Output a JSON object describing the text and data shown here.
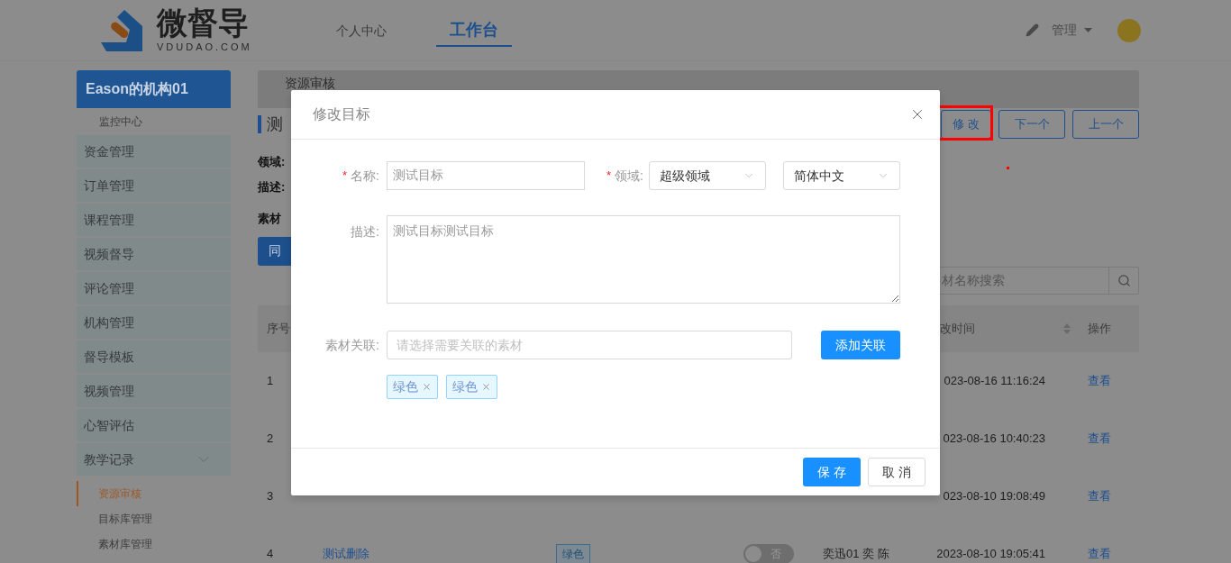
{
  "header": {
    "logo": {
      "name": "微督导",
      "domain": "VDUDAO.COM"
    },
    "nav": [
      {
        "label": "个人中心",
        "selected": false
      },
      {
        "label": "工作台",
        "selected": true
      }
    ],
    "user_menu": "管理"
  },
  "sidebar": {
    "org": "Eason的机构01",
    "top_link": "监控中心",
    "items": [
      {
        "label": "资金管理"
      },
      {
        "label": "订单管理"
      },
      {
        "label": "课程管理"
      },
      {
        "label": "视频督导"
      },
      {
        "label": "评论管理"
      },
      {
        "label": "机构管理"
      },
      {
        "label": "督导模板"
      },
      {
        "label": "视频管理"
      },
      {
        "label": "心智评估"
      },
      {
        "label": "教学记录",
        "expanded": true,
        "children": [
          {
            "label": "资源审核",
            "selected": true
          },
          {
            "label": "目标库管理",
            "selected": false
          },
          {
            "label": "素材库管理",
            "selected": false
          }
        ]
      }
    ]
  },
  "main": {
    "tab": "资源审核",
    "title": "测",
    "fields": [
      "领域:",
      "描述:",
      "素材"
    ],
    "action_buttons": [
      "修 改",
      "下一个",
      "上一个"
    ],
    "approve_button": "同",
    "search": {
      "placeholder": "材名称搜索"
    },
    "table": {
      "columns": [
        {
          "label": "序号"
        },
        {
          "label": "改时间",
          "sortable": true
        },
        {
          "label": "操作"
        }
      ],
      "rows": [
        {
          "index": "1",
          "time": "023-08-16 11:16:24",
          "action": "查看"
        },
        {
          "index": "2",
          "time": "023-08-16 10:40:23",
          "action": "查看"
        },
        {
          "index": "3",
          "time": "023-08-10 19:08:49",
          "action": "查看"
        },
        {
          "index": "4",
          "name": "测试删除",
          "tag": "绿色",
          "toggle": {
            "on": false,
            "label": "否"
          },
          "person": "奕迅01 奕 陈",
          "time": "2023-08-10 19:05:41",
          "action": "查看"
        }
      ]
    }
  },
  "modal": {
    "title": "修改目标",
    "name": {
      "label": "名称:",
      "required_mark": "*",
      "value": "测试目标"
    },
    "domain": {
      "label": "领域:",
      "required_mark": "*",
      "value": "超级领域"
    },
    "language": {
      "value": "简体中文"
    },
    "description": {
      "label": "描述:",
      "value": "测试目标测试目标"
    },
    "material": {
      "label": "素材关联:",
      "placeholder": "请选择需要关联的素材",
      "button": "添加关联",
      "tags": [
        {
          "label": "绿色"
        },
        {
          "label": "绿色"
        }
      ]
    },
    "buttons": [
      {
        "label": "保 存",
        "kind": "primary"
      },
      {
        "label": "取 消",
        "kind": "default"
      }
    ]
  }
}
